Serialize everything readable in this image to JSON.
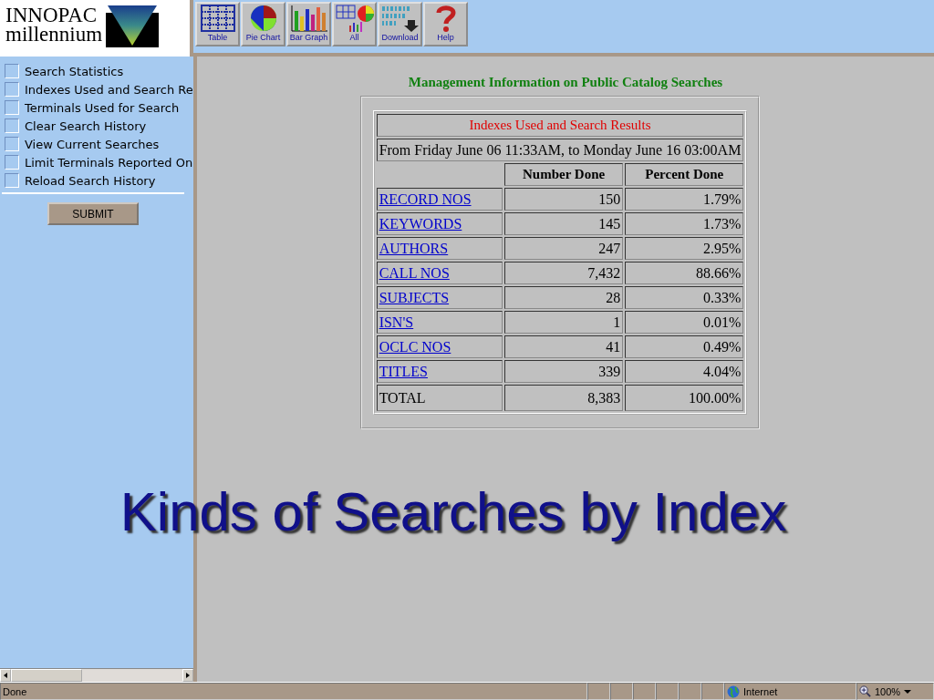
{
  "logo": {
    "line1": "INNOPAC",
    "line2": "millennium"
  },
  "toolbar": [
    {
      "label": "Table",
      "kind": "table"
    },
    {
      "label": "Pie Chart",
      "kind": "pie"
    },
    {
      "label": "Bar Graph",
      "kind": "bar"
    },
    {
      "label": "All",
      "kind": "all"
    },
    {
      "label": "Download",
      "kind": "download"
    },
    {
      "label": "Help",
      "kind": "help"
    }
  ],
  "sidebar": {
    "items": [
      {
        "label": "Search Statistics",
        "checked": false
      },
      {
        "label": "Indexes Used and Search Re",
        "checked": false
      },
      {
        "label": "Terminals Used for Search",
        "checked": false
      },
      {
        "label": "Clear Search History",
        "checked": false
      },
      {
        "label": "View Current Searches",
        "checked": false
      },
      {
        "label": "Limit Terminals Reported On",
        "checked": false
      },
      {
        "label": "Reload Search History",
        "checked": false
      }
    ],
    "submit": "SUBMIT"
  },
  "report": {
    "heading": "Management Information on Public Catalog Searches",
    "table": {
      "title": "Indexes Used and Search Results",
      "period": "From Friday June 06 11:33AM, to Monday June 16 03:00AM",
      "columns": [
        "Number Done",
        "Percent Done"
      ],
      "rows": [
        {
          "kind": "link",
          "index": "RECORD NOS",
          "number": "150",
          "percent": "1.79%"
        },
        {
          "kind": "link",
          "index": "KEYWORDS",
          "number": "145",
          "percent": "1.73%"
        },
        {
          "kind": "link",
          "index": "AUTHORS",
          "number": "247",
          "percent": "2.95%"
        },
        {
          "kind": "link",
          "index": "CALL NOS",
          "number": "7,432",
          "percent": "88.66%"
        },
        {
          "kind": "link",
          "index": "SUBJECTS",
          "number": "28",
          "percent": "0.33%"
        },
        {
          "kind": "link",
          "index": "ISN'S",
          "number": "1",
          "percent": "0.01%"
        },
        {
          "kind": "link",
          "index": "OCLC NOS",
          "number": "41",
          "percent": "0.49%"
        },
        {
          "kind": "link",
          "index": "TITLES",
          "number": "339",
          "percent": "4.04%"
        },
        {
          "kind": "total",
          "index": "TOTAL",
          "number": "8,383",
          "percent": "100.00%"
        }
      ]
    }
  },
  "caption": "Kinds of Searches by Index",
  "status_bar": {
    "text": "Done",
    "zone": "Internet",
    "zoom": "100%"
  }
}
